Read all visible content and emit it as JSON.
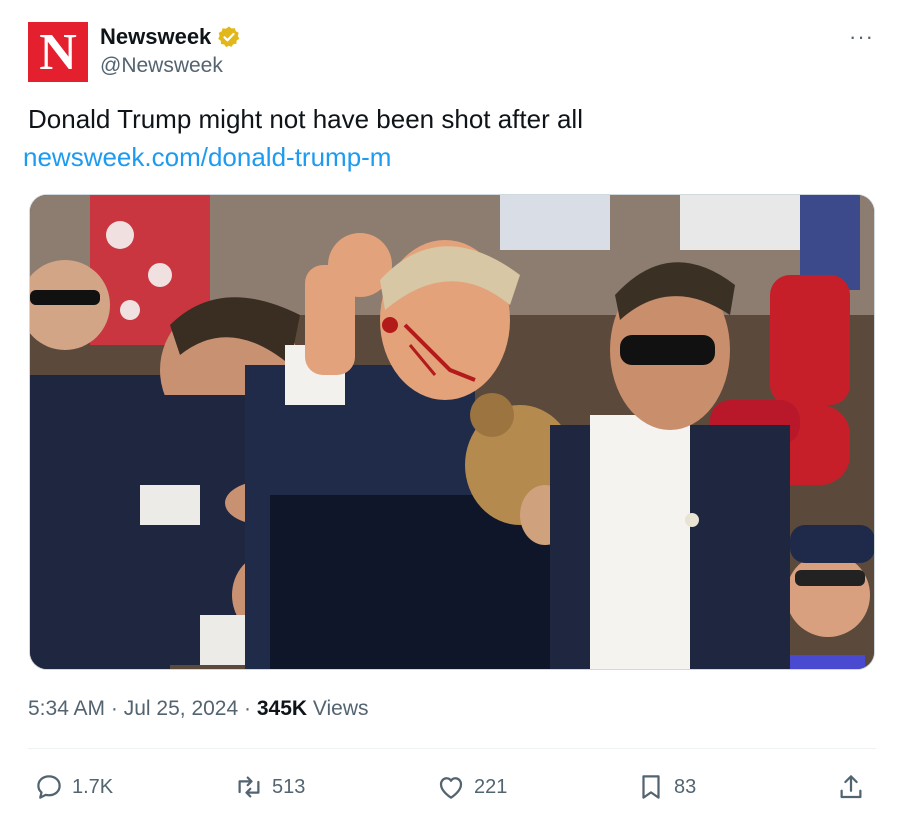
{
  "account": {
    "avatar_letter": "N",
    "name": "Newsweek",
    "handle": "@Newsweek",
    "verified_color": "#e2b719",
    "brand_color": "#e4202e"
  },
  "more_menu": "···",
  "tweet": {
    "text": "Donald Trump might not have been shot after all",
    "link": "newsweek.com/donald-trump-m"
  },
  "media": {
    "description": "rally-photo"
  },
  "meta": {
    "time": "5:34 AM",
    "sep1": " · ",
    "date": "Jul 25, 2024",
    "sep2": " · ",
    "views_count": "345K",
    "views_label": " Views"
  },
  "actions": {
    "replies": "1.7K",
    "reposts": "513",
    "likes": "221",
    "bookmarks": "83"
  },
  "colors": {
    "link": "#1d9bf0",
    "secondary_text": "#536471"
  }
}
